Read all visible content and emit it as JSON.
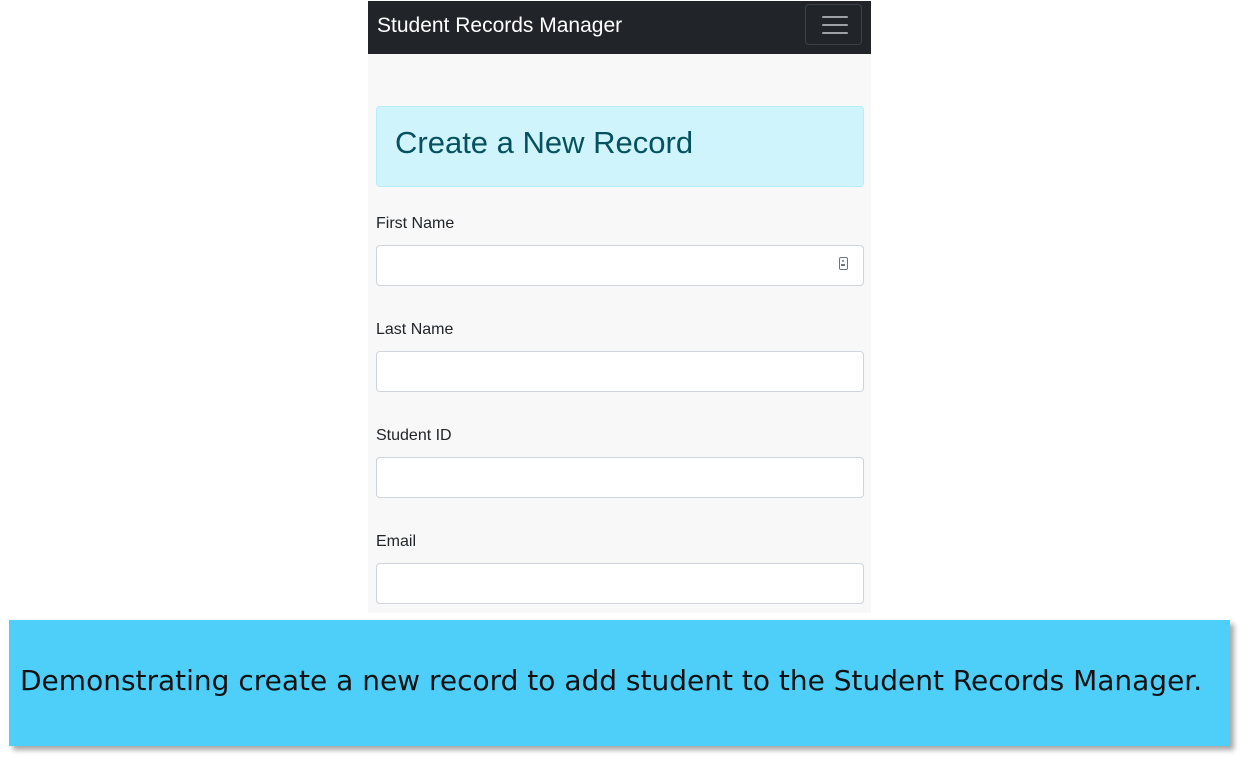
{
  "navbar": {
    "brand": "Student Records Manager",
    "toggler_icon": "hamburger-menu-icon"
  },
  "header": {
    "title": "Create a New Record",
    "color": "#055160",
    "background": "#cff4fc"
  },
  "form": {
    "first_name": {
      "label": "First Name",
      "value": "",
      "placeholder": ""
    },
    "last_name": {
      "label": "Last Name",
      "value": "",
      "placeholder": ""
    },
    "student_id": {
      "label": "Student ID",
      "value": "",
      "placeholder": ""
    },
    "email": {
      "label": "Email",
      "value": "",
      "placeholder": ""
    },
    "autofill_icon": "contact-card-icon"
  },
  "caption": {
    "text": "Demonstrating create a new record to add student to the Student Records Manager.",
    "background": "#4dcffa"
  }
}
